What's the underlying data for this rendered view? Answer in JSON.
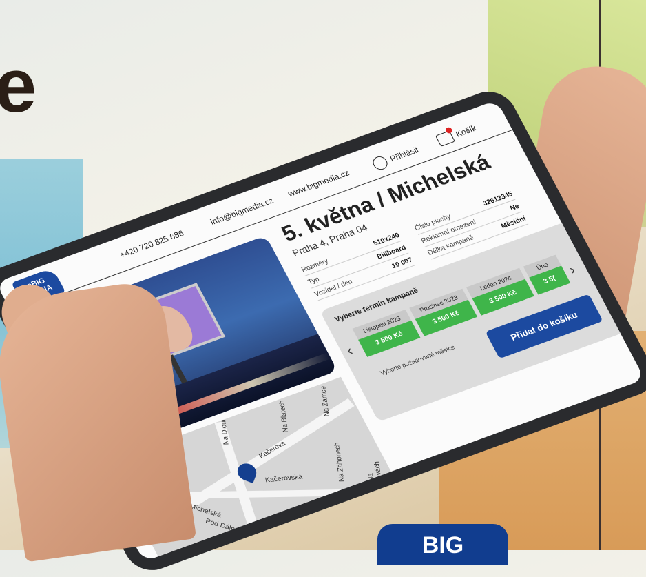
{
  "background": {
    "big_letter": "e",
    "badge_text": "BIG"
  },
  "header": {
    "logo": "eBIG MEDIA",
    "phone": "+420 720 825 686",
    "email": "info@bigmedia.cz",
    "website": "www.bigmedia.cz",
    "login_label": "Přihlásit",
    "cart_label": "Košík"
  },
  "listing": {
    "title": "5. května / Michelská",
    "subtitle": "Praha 4, Praha 04",
    "specs_left": [
      {
        "label": "Rozměry",
        "value": "510x240"
      },
      {
        "label": "Typ",
        "value": "Billboard"
      },
      {
        "label": "Vozidel / den",
        "value": "10 007"
      }
    ],
    "specs_right": [
      {
        "label": "Číslo plochy",
        "value": "32613345"
      },
      {
        "label": "Reklamní omezení",
        "value": "Ne"
      },
      {
        "label": "Délka kampaně",
        "value": "Měsíční"
      }
    ]
  },
  "booking": {
    "title": "Vyberte termín kampaně",
    "terms": [
      {
        "label": "Listopad 2023",
        "price": "3 500 Kč"
      },
      {
        "label": "Prosinec 2023",
        "price": "3 500 Kč"
      },
      {
        "label": "Leden 2024",
        "price": "3 500 Kč"
      },
      {
        "label": "Úno",
        "price": "3 5("
      }
    ],
    "hint": "Vyberte požadované měsíce",
    "add_to_cart": "Přidat do košíku",
    "prev_arrow": "‹",
    "next_arrow": "›"
  },
  "map": {
    "streets": [
      "Na Dlouhé",
      "Kačerova",
      "Kačerovská",
      "Michelská",
      "Pod Dálnicí",
      "Na Záhonech",
      "Na Nivách",
      "Na Zámce",
      "Na Blatech"
    ]
  }
}
